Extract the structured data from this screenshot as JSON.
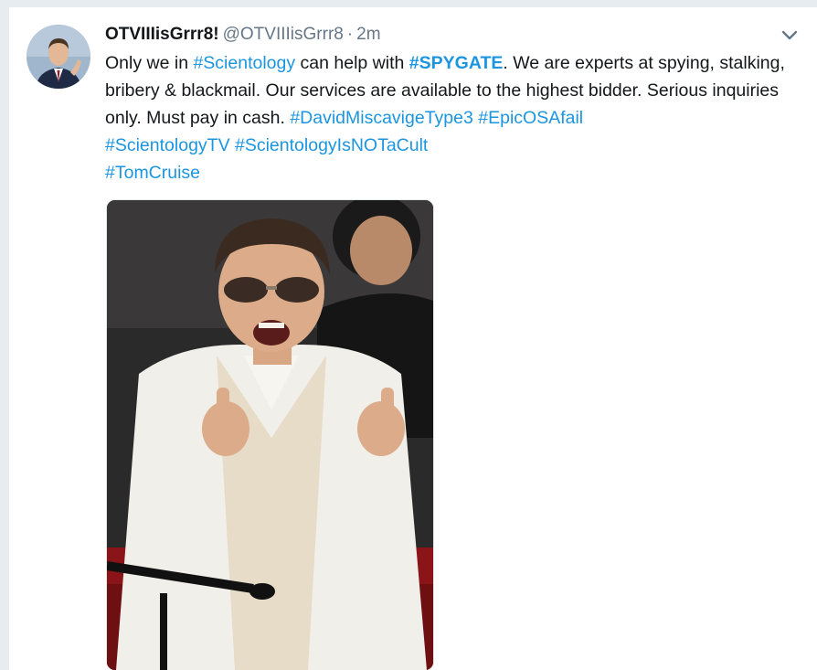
{
  "tweet": {
    "display_name": "OTVIIIisGrrr8!",
    "handle": "@OTVIIIisGrrr8",
    "separator": "·",
    "time": "2m",
    "text_segments": {
      "s1": "Only we in ",
      "h1": "#Scientology",
      "s2": " can help with ",
      "h2": "#SPYGATE",
      "s3": ". We are experts at spying, stalking, bribery & blackmail. Our services are available to the highest bidder. Serious inquiries only. Must pay in cash. ",
      "h3": "#DavidMiscavigeType3",
      "h4": "#EpicOSAfail",
      "h5": "#ScientologyTV",
      "h6": "#ScientologyIsNOTaCult",
      "h7": "#TomCruise"
    }
  },
  "icons": {
    "menu": "chevron-down-icon"
  },
  "colors": {
    "hashtag": "#1b95e0",
    "text": "#14171a",
    "secondary": "#657786",
    "background": "#e6ecf0"
  }
}
